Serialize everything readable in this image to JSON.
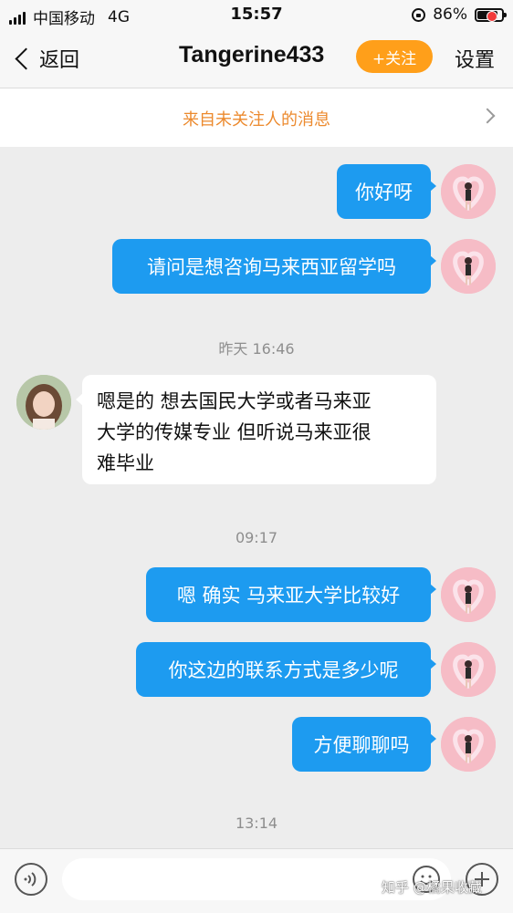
{
  "status": {
    "carrier": "中国移动",
    "network": "4G",
    "time": "15:57",
    "battery": "86%",
    "battery_level": 0.86
  },
  "nav": {
    "back_label": "返回",
    "title": "Tangerine433",
    "follow_label": "+关注",
    "settings_label": "设置"
  },
  "notice": {
    "text": "来自未关注人的消息"
  },
  "messages": {
    "m1": "你好呀",
    "m2": "请问是想咨询马来西亚留学吗",
    "ts1": "昨天 16:46",
    "r1_line1": "嗯是的 想去国民大学或者马来亚",
    "r1_line2": "大学的传媒专业 但听说马来亚很",
    "r1_line3": "难毕业",
    "ts2": "09:17",
    "m3": "嗯 确实 马来亚大学比较好",
    "m4": "你这边的联系方式是多少呢",
    "m5": "方便聊聊吗",
    "ts3": "13:14"
  },
  "input": {
    "placeholder": ""
  },
  "watermark": "知乎 @橘果收藏",
  "colors": {
    "outgoing_bubble": "#1d9bf0",
    "follow_button": "#ff9f1a",
    "notice_text": "#ec8a2e",
    "badge": "#f23b3b"
  },
  "icons": [
    "back-chevron-icon",
    "voice-icon",
    "emoji-icon",
    "plus-icon",
    "chevron-right-icon",
    "lock-rotation-icon",
    "battery-icon",
    "signal-icon"
  ]
}
